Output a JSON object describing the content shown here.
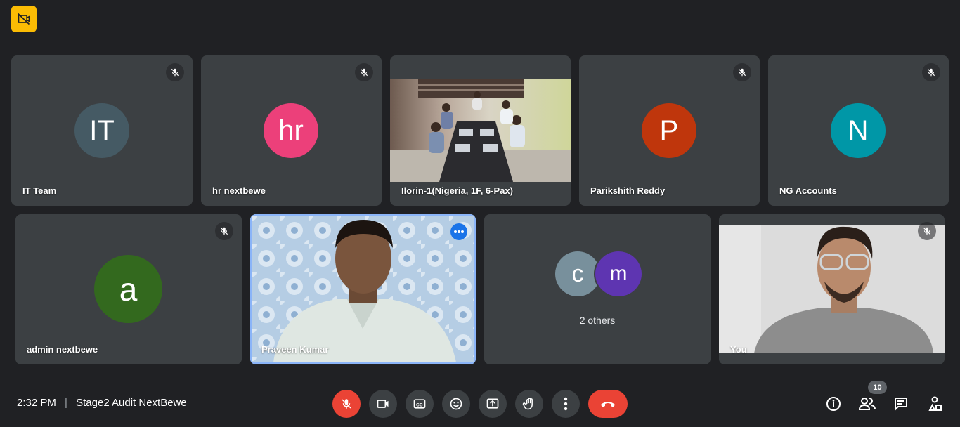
{
  "meeting": {
    "time": "2:32 PM",
    "separator": "|",
    "title": "Stage2 Audit NextBewe"
  },
  "participants_count": "10",
  "colors": {
    "bg": "#202124",
    "tile": "#3c4043",
    "end_call": "#ea4335",
    "active_speaker": "#8ab4f8",
    "recording_badge": "#fbbc04"
  },
  "tiles": [
    {
      "name": "IT Team",
      "initials": "IT",
      "avatar_color": "#455a64",
      "muted": true
    },
    {
      "name": "hr nextbewe",
      "initials": "hr",
      "avatar_color": "#ec407a",
      "muted": true
    },
    {
      "name": "Ilorin-1(Nigeria, 1F, 6-Pax)",
      "video": "conference-room",
      "muted": false
    },
    {
      "name": "Parikshith Reddy",
      "initials": "P",
      "avatar_color": "#bf360c",
      "muted": true
    },
    {
      "name": "NG Accounts",
      "initials": "N",
      "avatar_color": "#0097a7",
      "muted": true
    },
    {
      "name": "admin nextbewe",
      "initials": "a",
      "avatar_color": "#33691e",
      "muted": true
    },
    {
      "name": "Praveen Kumar",
      "video": "person",
      "muted": false,
      "speaking": true
    },
    {
      "others_label": "2 others",
      "initials": [
        "c",
        "m"
      ],
      "avatar_colors": [
        "#78909c",
        "#5e35b1"
      ]
    },
    {
      "name": "You",
      "video": "self",
      "muted": true
    }
  ],
  "icons": {
    "top": "recording-off-icon",
    "controls": [
      "mic-off-icon",
      "camera-icon",
      "captions-icon",
      "emoji-icon",
      "present-icon",
      "raise-hand-icon",
      "more-options-icon",
      "end-call-icon"
    ],
    "side": [
      "info-icon",
      "people-icon",
      "chat-icon",
      "activities-icon"
    ]
  }
}
